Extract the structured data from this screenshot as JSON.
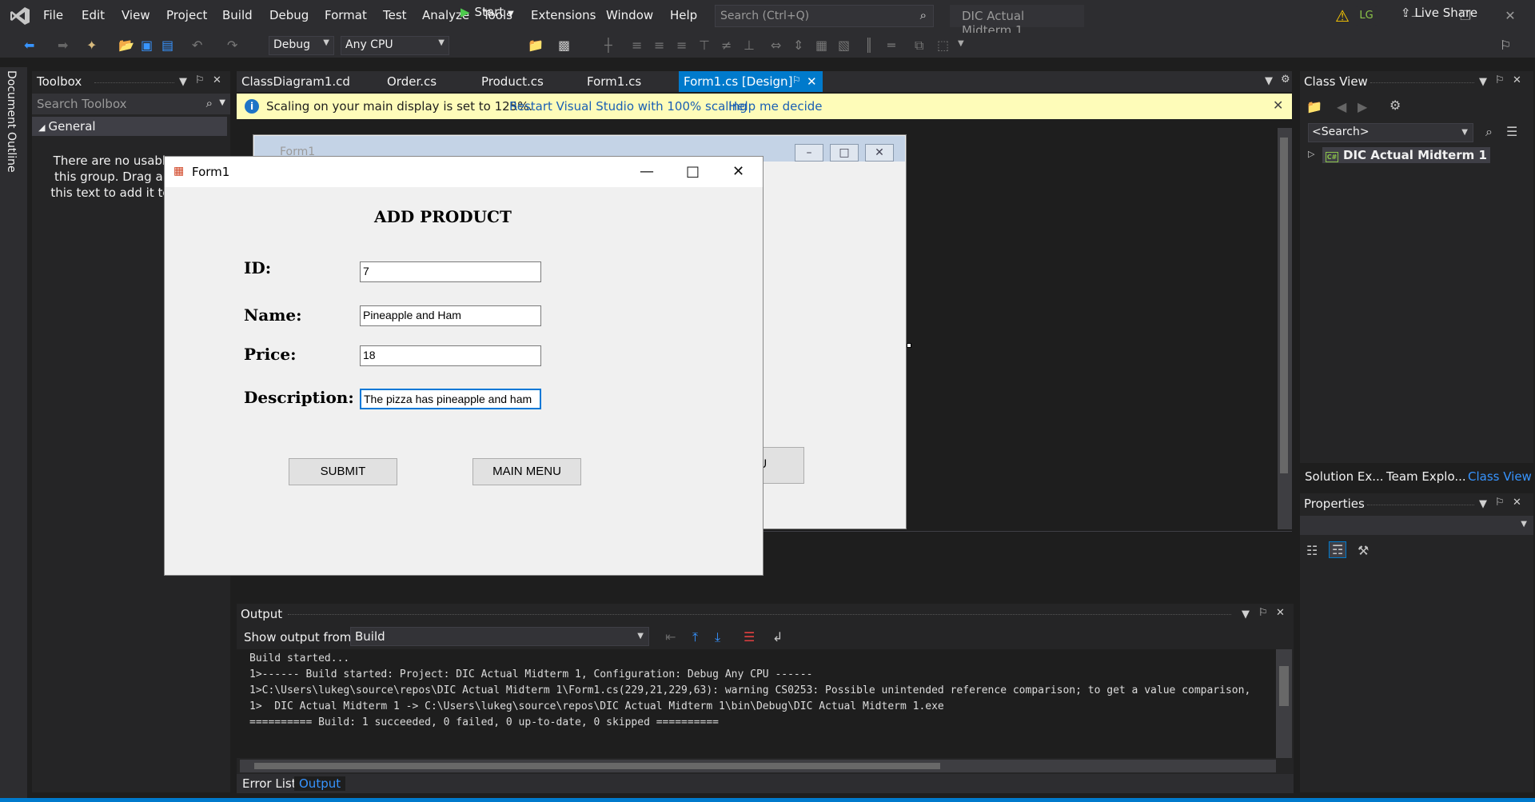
{
  "menu": {
    "items": [
      "File",
      "Edit",
      "View",
      "Project",
      "Build",
      "Debug",
      "Format",
      "Test",
      "Analyze",
      "Tools",
      "Extensions",
      "Window",
      "Help"
    ],
    "search_placeholder": "Search (Ctrl+Q)",
    "solution_name": "DIC Actual Midterm 1",
    "user_initials": "LG"
  },
  "toolbar": {
    "config": "Debug",
    "platform": "Any CPU",
    "start_label": "Start",
    "live_share": "Live Share"
  },
  "left_strip": {
    "label": "Document Outline"
  },
  "toolbox": {
    "title": "Toolbox",
    "search_placeholder": "Search Toolbox",
    "group": "General",
    "empty_line1": "There are no usable c",
    "empty_line2": "this group. Drag an it",
    "empty_line3": "this text to add it to th"
  },
  "doc_tabs": [
    {
      "label": "ClassDiagram1.cd"
    },
    {
      "label": "Order.cs"
    },
    {
      "label": "Product.cs"
    },
    {
      "label": "Form1.cs"
    },
    {
      "label": "Form1.cs [Design]"
    }
  ],
  "infobar": {
    "message": "Scaling on your main display is set to 125%.",
    "link1": "Restart Visual Studio with 100% scaling",
    "link2": "Help me decide"
  },
  "designer": {
    "form_title": "Form1",
    "button_fragment": "U"
  },
  "running_form": {
    "title": "Form1",
    "heading": "ADD PRODUCT",
    "labels": {
      "id": "ID:",
      "name": "Name:",
      "price": "Price:",
      "description": "Description:"
    },
    "values": {
      "id": "7",
      "name": "Pineapple and Ham",
      "price": "18",
      "description": "The pizza has pineapple and ham"
    },
    "submit": "SUBMIT",
    "main_menu": "MAIN MENU"
  },
  "output": {
    "title": "Output",
    "show_from_label": "Show output from:",
    "source": "Build",
    "lines": [
      "Build started...",
      "1>------ Build started: Project: DIC Actual Midterm 1, Configuration: Debug Any CPU ------",
      "1>C:\\Users\\lukeg\\source\\repos\\DIC Actual Midterm 1\\Form1.cs(229,21,229,63): warning CS0253: Possible unintended reference comparison; to get a value comparison,",
      "1>  DIC Actual Midterm 1 -> C:\\Users\\lukeg\\source\\repos\\DIC Actual Midterm 1\\bin\\Debug\\DIC Actual Midterm 1.exe",
      "========== Build: 1 succeeded, 0 failed, 0 up-to-date, 0 skipped =========="
    ]
  },
  "bottom_tabs": [
    "Error List",
    "Output"
  ],
  "class_view": {
    "title": "Class View",
    "search": "<Search>",
    "node": "DIC Actual Midterm 1"
  },
  "right_tabs": [
    "Solution Ex...",
    "Team Explo...",
    "Class View"
  ],
  "properties": {
    "title": "Properties"
  },
  "colors": {
    "accent": "#007acc",
    "infobar": "#fefcb9",
    "background": "#1e1e1e"
  }
}
